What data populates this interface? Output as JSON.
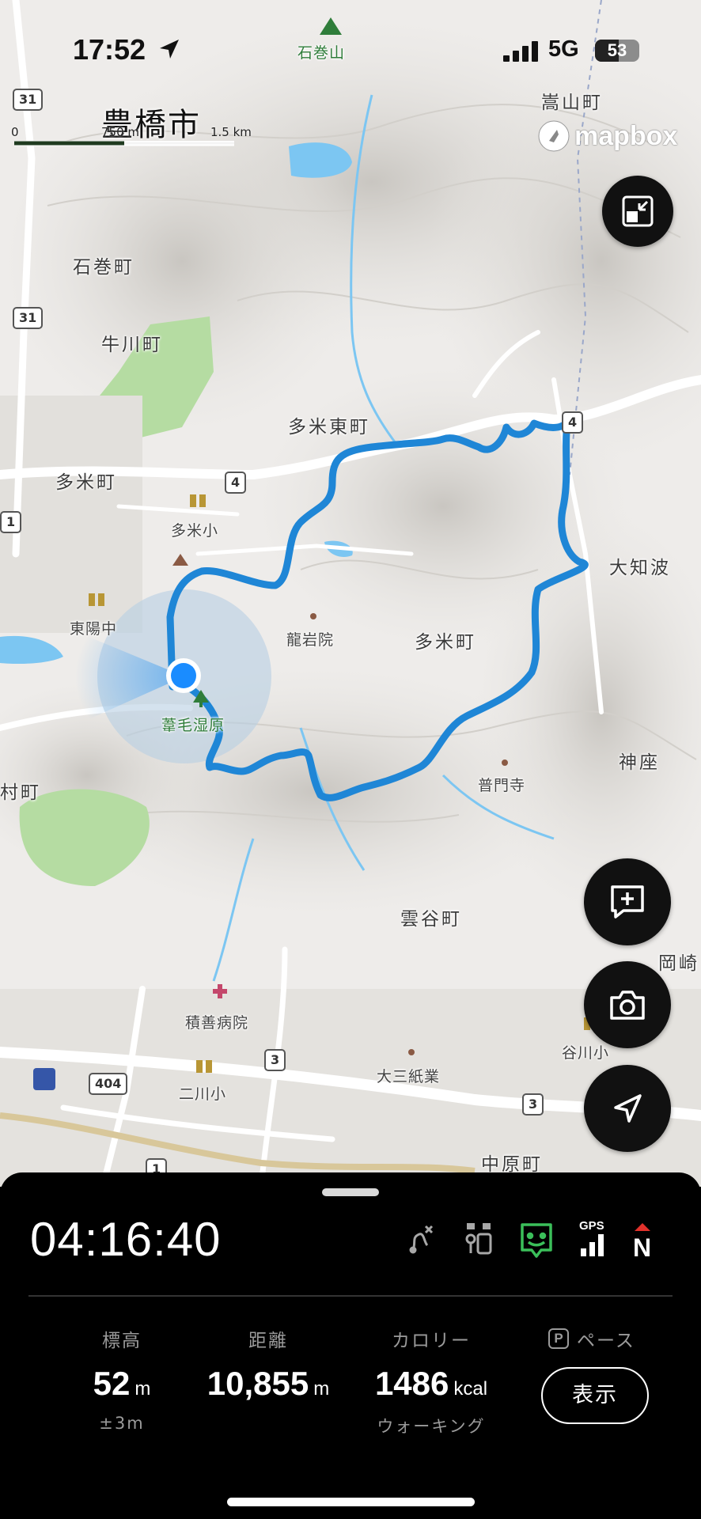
{
  "status_bar": {
    "time": "17:52",
    "network": "5G",
    "battery_percent": "53"
  },
  "map": {
    "city": "豊橋市",
    "scale": {
      "zero": "0",
      "mid": "750 m",
      "end": "1.5 km"
    },
    "attribution": "mapbox",
    "place_labels": [
      "石巻山",
      "嵩山町",
      "石巻町",
      "牛川町",
      "多米東町",
      "多米町",
      "多米小",
      "大知波",
      "東陽中",
      "龍岩院",
      "多米町",
      "葦毛湿原",
      "村町",
      "神座",
      "普門寺",
      "雲谷町",
      "岡崎",
      "積善病院",
      "大三紙業",
      "谷川小",
      "二川小",
      "中原町"
    ],
    "road_numbers": [
      "31",
      "31",
      "4",
      "4",
      "1",
      "3",
      "3",
      "404",
      "1"
    ]
  },
  "panel": {
    "elapsed_time": "04:16:40",
    "stats": {
      "elevation": {
        "label": "標高",
        "value": "52",
        "unit": "m",
        "sub": "±3m"
      },
      "distance": {
        "label": "距離",
        "value": "10,855",
        "unit": "m"
      },
      "calories": {
        "label": "カロリー",
        "value": "1486",
        "unit": "kcal",
        "sub": "ウォーキング"
      },
      "pace": {
        "label": "ペース",
        "badge": "P",
        "button": "表示"
      }
    },
    "gps_label": "GPS",
    "compass_label": "N"
  },
  "colors": {
    "route": "#1f86d6",
    "location_dot": "#1a8cff",
    "panel_bg": "#000000",
    "active_icon": "#3bbf5a",
    "compass_red": "#e0312b"
  }
}
